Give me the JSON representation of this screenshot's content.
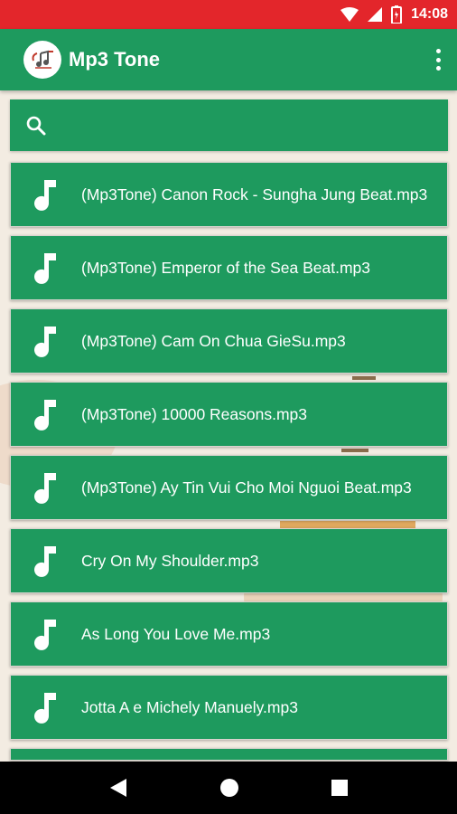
{
  "status_bar": {
    "time": "14:08",
    "icons": [
      "wifi-icon",
      "signal-icon",
      "battery-icon"
    ]
  },
  "app_bar": {
    "title": "Mp3 Tone",
    "logo_icon": "music-logo-icon",
    "menu_icon": "more-vert-icon"
  },
  "search": {
    "icon": "search-icon",
    "value": "",
    "placeholder": ""
  },
  "songs": [
    {
      "title": "(Mp3Tone) Canon Rock - Sungha Jung Beat.mp3"
    },
    {
      "title": "(Mp3Tone) Emperor of the Sea Beat.mp3"
    },
    {
      "title": "(Mp3Tone) Cam On Chua GieSu.mp3"
    },
    {
      "title": "(Mp3Tone) 10000 Reasons.mp3"
    },
    {
      "title": "(Mp3Tone) Ay Tin Vui Cho Moi Nguoi Beat.mp3"
    },
    {
      "title": "Cry On My Shoulder.mp3"
    },
    {
      "title": "As Long You Love Me.mp3"
    },
    {
      "title": "Jotta A e Michely Manuely.mp3"
    }
  ],
  "nav_bar": {
    "back_icon": "back-triangle-icon",
    "home_icon": "home-circle-icon",
    "recents_icon": "recents-square-icon"
  },
  "colors": {
    "status_bar": "#e3262b",
    "primary": "#1e9a5e",
    "background": "#f3ece2",
    "nav_bar": "#000000"
  }
}
